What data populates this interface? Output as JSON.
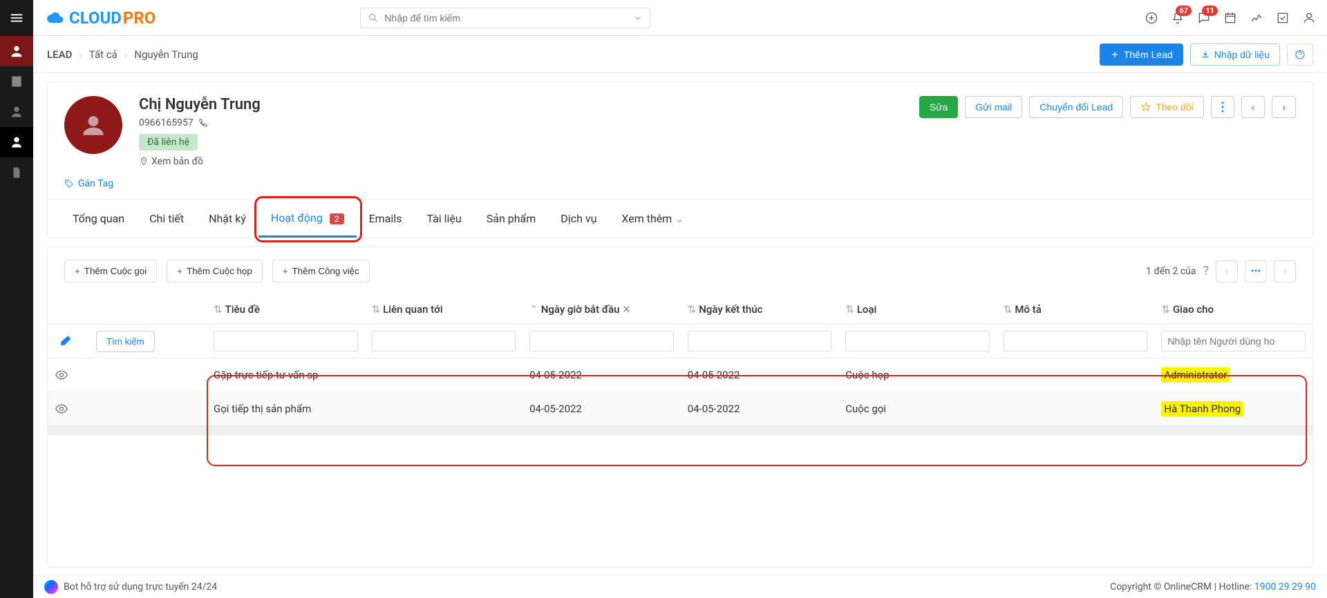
{
  "search": {
    "placeholder": "Nhập để tìm kiếm"
  },
  "topbar": {
    "bell_badge": "67",
    "chat_badge": "11"
  },
  "breadcrumb": {
    "module": "LEAD",
    "all": "Tất cả",
    "name": "Nguyễn Trung"
  },
  "header_actions": {
    "add_lead": "Thêm Lead",
    "import": "Nhập dữ liệu"
  },
  "lead": {
    "name": "Chị Nguyễn Trung",
    "phone": "0966165957",
    "status": "Đã liên hệ",
    "map": "Xem bản đồ",
    "tag": "Gán Tag"
  },
  "lead_actions": {
    "edit": "Sửa",
    "mail": "Gửi mail",
    "convert": "Chuyển đổi Lead",
    "follow": "Theo dõi"
  },
  "tabs": {
    "overview": "Tổng quan",
    "detail": "Chi tiết",
    "log": "Nhật ký",
    "activity": "Hoạt động",
    "activity_count": "2",
    "emails": "Emails",
    "docs": "Tài liệu",
    "products": "Sản phẩm",
    "services": "Dịch vụ",
    "more": "Xem thêm"
  },
  "add_buttons": {
    "call": "Thêm Cuộc gọi",
    "meeting": "Thêm Cuộc họp",
    "task": "Thêm Công việc"
  },
  "pagination": {
    "text": "1 đến 2 của"
  },
  "columns": {
    "title": "Tiêu đề",
    "related": "Liên quan tới",
    "start": "Ngày giờ bắt đầu",
    "end": "Ngày kết thúc",
    "type": "Loại",
    "desc": "Mô tả",
    "assigned": "Giao cho"
  },
  "filter": {
    "search": "Tìm kiếm",
    "assigned_placeholder": "Nhập tên Người dùng ho"
  },
  "rows": [
    {
      "title": "Gặp trực tiếp tư vấn sp",
      "start": "04-05-2022",
      "end": "04-05-2022",
      "type": "Cuộc họp",
      "assigned": "Administrator"
    },
    {
      "title": "Gọi tiếp thị sản phẩm",
      "start": "04-05-2022",
      "end": "04-05-2022",
      "type": "Cuộc gọi",
      "assigned": "Hà Thanh Phong"
    }
  ],
  "footer": {
    "bot": "Bot hỗ trợ sử dụng trực tuyến 24/24",
    "copyright": "Copyright © OnlineCRM",
    "hotline_label": "Hotline:",
    "hotline": "1900 29 29 90"
  }
}
